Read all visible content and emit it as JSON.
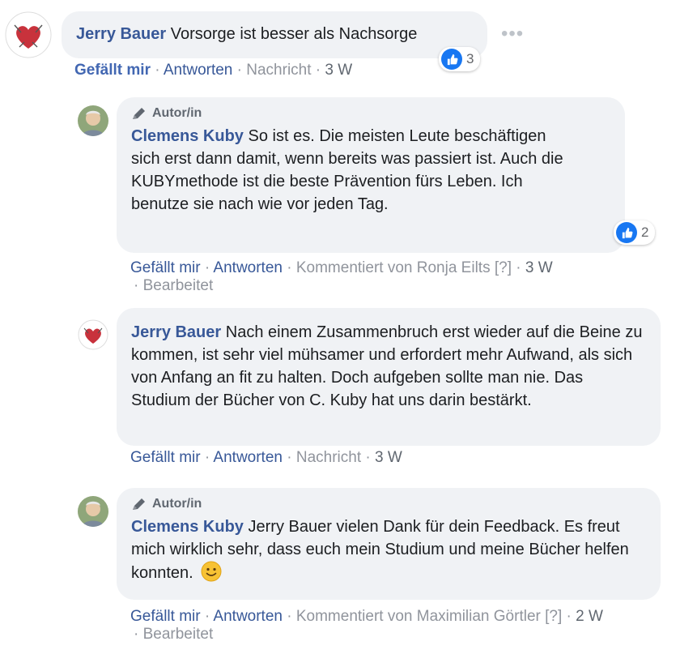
{
  "comment1": {
    "author": "Jerry Bauer",
    "text": "Vorsorge ist besser als Nachsorge",
    "reactions": "3",
    "like": "Gefällt mir",
    "reply": "Antworten",
    "message": "Nachricht",
    "time": "3 W"
  },
  "reply1": {
    "badge": "Autor/in",
    "author": "Clemens Kuby",
    "text": "So ist es. Die meisten Leute beschäftigen sich erst dann damit, wenn bereits was passiert ist. Auch die KUBYmethode ist die beste Prävention fürs Leben. Ich benutze sie nach wie vor jeden Tag.",
    "reactions": "2",
    "like": "Gefällt mir",
    "reply": "Antworten",
    "commented_by": "Kommentiert von Ronja Eilts",
    "help": "[?]",
    "time": "3 W",
    "edited": "Bearbeitet"
  },
  "reply2": {
    "author": "Jerry Bauer",
    "text": "Nach einem Zusammenbruch erst wieder auf die Beine zu kommen, ist sehr viel mühsamer und erfordert mehr Aufwand, als sich von Anfang an fit zu halten. Doch aufgeben sollte man nie. Das Studium der Bücher von C. Kuby hat uns darin bestärkt.",
    "like": "Gefällt mir",
    "reply": "Antworten",
    "message": "Nachricht",
    "time": "3 W"
  },
  "reply3": {
    "badge": "Autor/in",
    "author": "Clemens Kuby",
    "text": "Jerry Bauer vielen Dank für dein Feedback. Es freut mich wirklich sehr, dass euch mein Studium und meine Bücher helfen konnten.",
    "like": "Gefällt mir",
    "reply": "Antworten",
    "commented_by": "Kommentiert von Maximilian Görtler",
    "help": "[?]",
    "time": "2 W",
    "edited": "Bearbeitet"
  },
  "colors": {
    "link": "#385898",
    "bubble": "#f0f2f5",
    "like": "#1877f2"
  }
}
